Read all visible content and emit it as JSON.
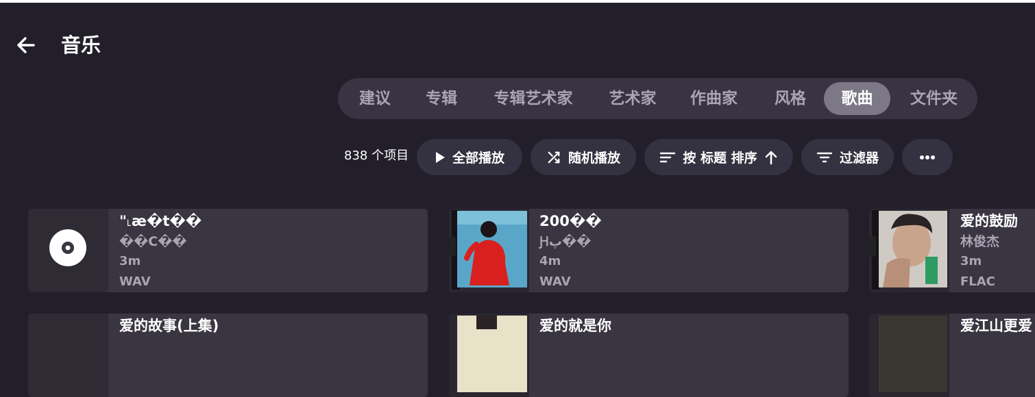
{
  "header": {
    "title": "音乐"
  },
  "tabs": [
    {
      "label": "建议",
      "active": false
    },
    {
      "label": "专辑",
      "active": false
    },
    {
      "label": "专辑艺术家",
      "active": false
    },
    {
      "label": "艺术家",
      "active": false
    },
    {
      "label": "作曲家",
      "active": false
    },
    {
      "label": "风格",
      "active": false
    },
    {
      "label": "歌曲",
      "active": true
    },
    {
      "label": "文件夹",
      "active": false
    }
  ],
  "toolbar": {
    "count": "838 个项目",
    "play_all": "全部播放",
    "shuffle": "随机播放",
    "sort": "按 标题 排序",
    "filter": "过滤器"
  },
  "songs": [
    {
      "title": "\"˪æ�t��",
      "artist": "��C��",
      "duration": "3m",
      "format": "WAV",
      "art": "disc-icon"
    },
    {
      "title": "200��",
      "artist": "Ԩپ��",
      "duration": "4m",
      "format": "WAV",
      "art": "album-cover-red"
    },
    {
      "title": "爱的鼓励",
      "artist": "林俊杰",
      "duration": "3m",
      "format": "FLAC",
      "art": "album-cover-portrait"
    },
    {
      "title": "爱的故事(上集)",
      "artist": "",
      "duration": "",
      "format": "",
      "art": "disc-icon"
    },
    {
      "title": "爱的就是你",
      "artist": "",
      "duration": "",
      "format": "",
      "art": "album-cover"
    },
    {
      "title": "爱江山更爱",
      "artist": "",
      "duration": "",
      "format": "",
      "art": "album-cover"
    }
  ],
  "colors": {
    "background": "#221f2b",
    "tab_bar": "#383442",
    "tab_active": "#7c7887",
    "pill": "#343140",
    "card": "#393541"
  }
}
